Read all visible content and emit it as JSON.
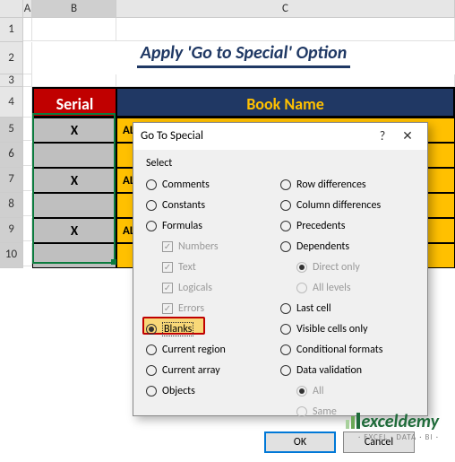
{
  "columns": {
    "A": "A",
    "B": "B",
    "C": "C"
  },
  "rows": [
    "1",
    "2",
    "3",
    "4",
    "5",
    "6",
    "7",
    "8",
    "9",
    "10"
  ],
  "title": "Apply 'Go to Special' Option",
  "headers": {
    "serial": "Serial",
    "book": "Book Name"
  },
  "data": [
    {
      "serial": "X",
      "book": "ALL THE LIGHT WE CANNOT SEE"
    },
    {
      "serial": "",
      "book": ""
    },
    {
      "serial": "X",
      "book": "ALL THE LIGHT WE CANNOT SEE"
    },
    {
      "serial": "",
      "book": ""
    },
    {
      "serial": "X",
      "book": "ALL THE LIGHT WE CANNOT SEE"
    },
    {
      "serial": "",
      "book": ""
    }
  ],
  "dialog": {
    "title": "Go To Special",
    "select_label": "Select",
    "help": "?",
    "close": "✕",
    "left": {
      "comments": "Comments",
      "constants": "Constants",
      "formulas": "Formulas",
      "numbers": "Numbers",
      "text": "Text",
      "logicals": "Logicals",
      "errors": "Errors",
      "blanks": "Blanks",
      "current_region": "Current region",
      "current_array": "Current array",
      "objects": "Objects"
    },
    "right": {
      "row_diff": "Row differences",
      "col_diff": "Column differences",
      "precedents": "Precedents",
      "dependents": "Dependents",
      "direct_only": "Direct only",
      "all_levels": "All levels",
      "last_cell": "Last cell",
      "visible": "Visible cells only",
      "cond_fmt": "Conditional formats",
      "data_val": "Data validation",
      "all": "All",
      "same": "Same"
    },
    "ok": "OK",
    "cancel": "Cancel"
  },
  "logo": {
    "brand": "exceldemy",
    "tag": "· EXCEL · DATA · BI ·"
  }
}
